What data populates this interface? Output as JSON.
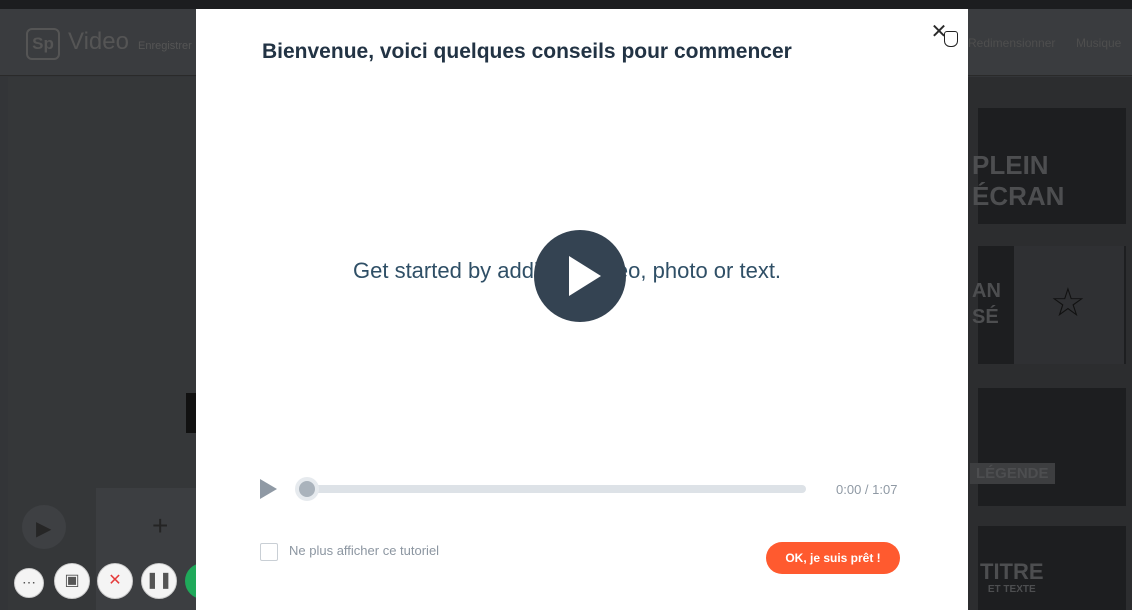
{
  "background_app": {
    "logo_text": "Sp",
    "brand": "Video",
    "nav_left": "Enregistrer",
    "nav_right": [
      "Redimensionner",
      "Musique"
    ],
    "layout_tiles": [
      "PLEIN ÉCRAN",
      "AN\nSÉ",
      "LÉGENDE",
      "TITRE",
      "ET TEXTE"
    ],
    "icons": {
      "play": "play-icon",
      "add": "plus-icon",
      "star": "star-icon"
    }
  },
  "modal": {
    "title": "Bienvenue, voici quelques conseils pour commencer",
    "close_icon": "close-icon",
    "video_text": "Get started by adding a video, photo or text.",
    "time": "0:00 / 1:07",
    "progress": 0,
    "checkbox_label": "Ne plus afficher ce tutoriel",
    "ok_button": "OK, je suis prêt !"
  },
  "recorder": {
    "buttons": [
      "more-icon",
      "camera-icon",
      "cancel-icon",
      "pause-icon",
      "check-icon"
    ]
  },
  "colors": {
    "accent": "#ff5a2f",
    "title": "#223344",
    "success": "#1fa95a"
  }
}
